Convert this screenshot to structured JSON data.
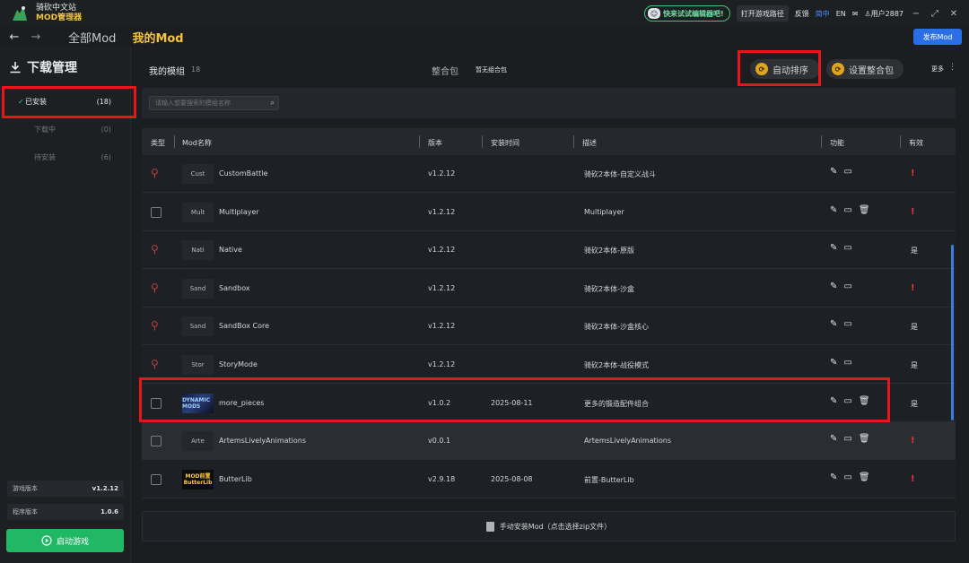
{
  "app": {
    "name_line1": "骑砍中文站",
    "name_line2": "MOD管理器"
  },
  "titlebar": {
    "promo": "快来试试编辑器吧!",
    "open_path": "打开游戏路径",
    "feedback": "反馈",
    "lang_cn": "简中",
    "lang_en": "EN",
    "user": "用户2887",
    "min": "−",
    "max": "⤢",
    "close": "✕"
  },
  "nav": {
    "back": "←",
    "forward": "→",
    "tab_all": "全部Mod",
    "tab_my": "我的Mod",
    "publish": "发布Mod"
  },
  "sidebar": {
    "title": "下载管理",
    "items": [
      {
        "label": "已安装",
        "count": "(18)",
        "check": "✓"
      },
      {
        "label": "下载中",
        "count": "(0)"
      },
      {
        "label": "待安装",
        "count": "(6)"
      }
    ],
    "game_version_label": "游戏版本",
    "game_version": "v1.2.12",
    "program_version_label": "程序版本",
    "program_version": "1.0.6",
    "launch": "启动游戏"
  },
  "main": {
    "title": "我的模组",
    "count": "18",
    "pack_label": "整合包",
    "no_pack": "暂无组合包",
    "auto_sort": "自动排序",
    "set_pack": "设置整合包",
    "more": "更多",
    "search_placeholder": "请输入想要搜索的模组名称",
    "manual_install": "手动安装Mod（点击选择zip文件）"
  },
  "table": {
    "headers": {
      "type": "类型",
      "name": "Mod名称",
      "version": "版本",
      "date": "安装时间",
      "desc": "描述",
      "func": "功能",
      "valid": "有效"
    },
    "rows": [
      {
        "type": "pin",
        "thumb": "Cust",
        "name": "CustomBattle",
        "version": "v1.2.12",
        "date": "",
        "desc": "骑砍2本体-自定义战斗",
        "delete": false,
        "valid": "!"
      },
      {
        "type": "check",
        "thumb": "Mult",
        "name": "Multiplayer",
        "version": "v1.2.12",
        "date": "",
        "desc": "Multiplayer",
        "delete": true,
        "valid": "!"
      },
      {
        "type": "pin",
        "thumb": "Nati",
        "name": "Native",
        "version": "v1.2.12",
        "date": "",
        "desc": "骑砍2本体-原版",
        "delete": false,
        "valid": "是"
      },
      {
        "type": "pin",
        "thumb": "Sand",
        "name": "Sandbox",
        "version": "v1.2.12",
        "date": "",
        "desc": "骑砍2本体-沙盒",
        "delete": false,
        "valid": "!"
      },
      {
        "type": "pin",
        "thumb": "Sand",
        "name": "SandBox Core",
        "version": "v1.2.12",
        "date": "",
        "desc": "骑砍2本体-沙盒核心",
        "delete": false,
        "valid": "是"
      },
      {
        "type": "pin",
        "thumb": "Stor",
        "name": "StoryMode",
        "version": "v1.2.12",
        "date": "",
        "desc": "骑砍2本体-战役模式",
        "delete": false,
        "valid": "是"
      },
      {
        "type": "check",
        "thumb": "img1",
        "name": "more_pieces",
        "version": "v1.0.2",
        "date": "2025-08-11",
        "desc": "更多的锻造配件组合",
        "delete": true,
        "valid": "是"
      },
      {
        "type": "check",
        "thumb": "Arte",
        "name": "ArtemsLivelyAnimations",
        "version": "v0.0.1",
        "date": "",
        "desc": "ArtemsLivelyAnimations",
        "delete": true,
        "valid": "!"
      },
      {
        "type": "check",
        "thumb": "img2",
        "name": "ButterLib",
        "version": "v2.9.18",
        "date": "2025-08-08",
        "desc": "前置-ButterLib",
        "delete": true,
        "valid": "!"
      }
    ]
  },
  "thumb_text": {
    "img1": "DYNAMIC MODS",
    "img2_l1": "MOD前置",
    "img2_l2": "ButterLib"
  },
  "colors": {
    "accent_green": "#21b865",
    "accent_gold": "#f5c33b",
    "publish_blue": "#2a6fe6",
    "invalid_red": "#e8343a"
  }
}
